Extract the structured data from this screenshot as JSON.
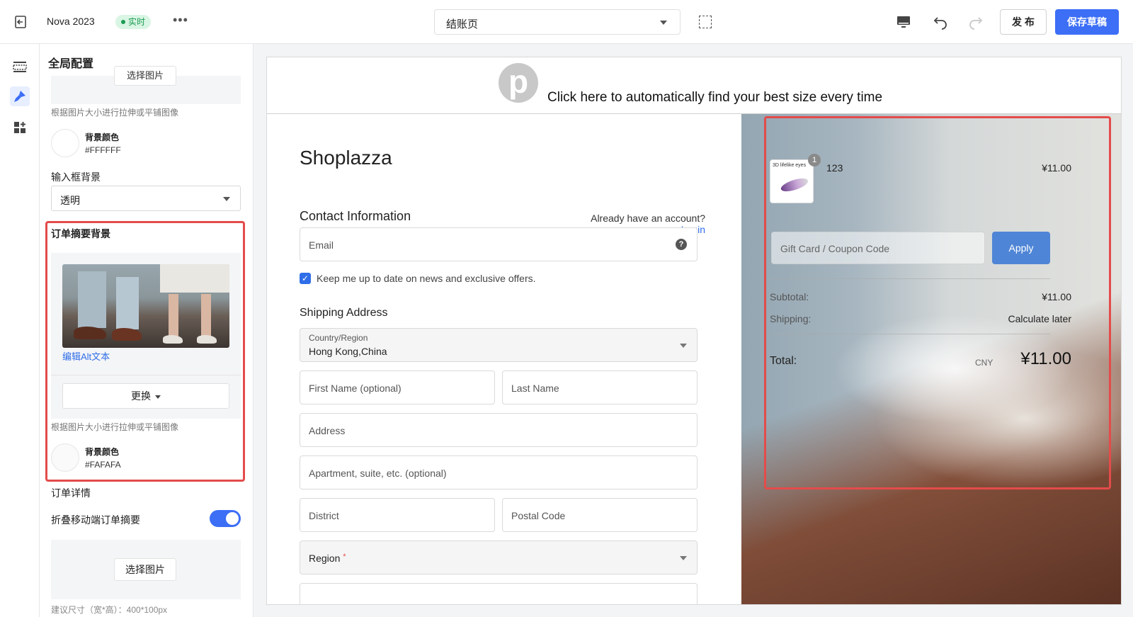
{
  "topbar": {
    "store_name": "Nova 2023",
    "live_badge": "实时",
    "more": "•••",
    "page_select": "结账页",
    "publish": "发 布",
    "save_draft": "保存草稿"
  },
  "panel": {
    "title": "全局配置",
    "top_image_button": "选择图片",
    "hint_stretch_1": "根据图片大小进行拉伸或平铺图像",
    "bg_color_label_1": "背景颜色",
    "bg_color_value_1": "#FFFFFF",
    "input_bg_label": "输入框背景",
    "input_bg_value": "透明",
    "order_summary_bg_label": "订单摘要背景",
    "edit_alt_text": "编辑Alt文本",
    "replace_button": "更换",
    "hint_stretch_2": "根据图片大小进行拉伸或平铺图像",
    "bg_color_label_2": "背景颜色",
    "bg_color_value_2": "#FAFAFA",
    "order_details_label": "订单详情",
    "collapse_mobile_label": "折叠移动端订单摘要",
    "collapse_mobile_on": true,
    "bottom_image_button": "选择图片",
    "bottom_hint_cut": "建议尺寸（宽*高）：400*100px"
  },
  "preview": {
    "banner_text": "Click here to automatically find your best size every time",
    "banner_logo_letter": "p",
    "brand": "Shoplazza",
    "contact_title": "Contact Information",
    "have_account": "Already have an account?",
    "login": "Login",
    "email_placeholder": "Email",
    "help_icon_glyph": "?",
    "newsletter_label": "Keep me up to date on news and exclusive offers.",
    "newsletter_checked": true,
    "shipping_title": "Shipping Address",
    "country_label": "Country/Region",
    "country_value": "Hong Kong,China",
    "first_name_placeholder": "First Name (optional)",
    "last_name_placeholder": "Last Name",
    "address_placeholder": "Address",
    "apartment_placeholder": "Apartment, suite, etc. (optional)",
    "district_placeholder": "District",
    "postal_placeholder": "Postal Code",
    "region_placeholder": "Region",
    "required_mark": "*"
  },
  "summary": {
    "product_thumb_text": "3D lifelike eyes",
    "product_qty": "1",
    "product_name": "123",
    "product_price": "¥11.00",
    "coupon_placeholder": "Gift Card / Coupon Code",
    "apply": "Apply",
    "subtotal_label": "Subtotal:",
    "subtotal_value": "¥11.00",
    "shipping_label": "Shipping:",
    "shipping_value": "Calculate later",
    "total_label": "Total:",
    "currency": "CNY",
    "total_value": "¥11.00"
  },
  "colors": {
    "accent": "#3c6ef6",
    "highlight_red": "#e44b4b",
    "live_green": "#1c9c53",
    "apply_blue": "#4f85d6"
  }
}
